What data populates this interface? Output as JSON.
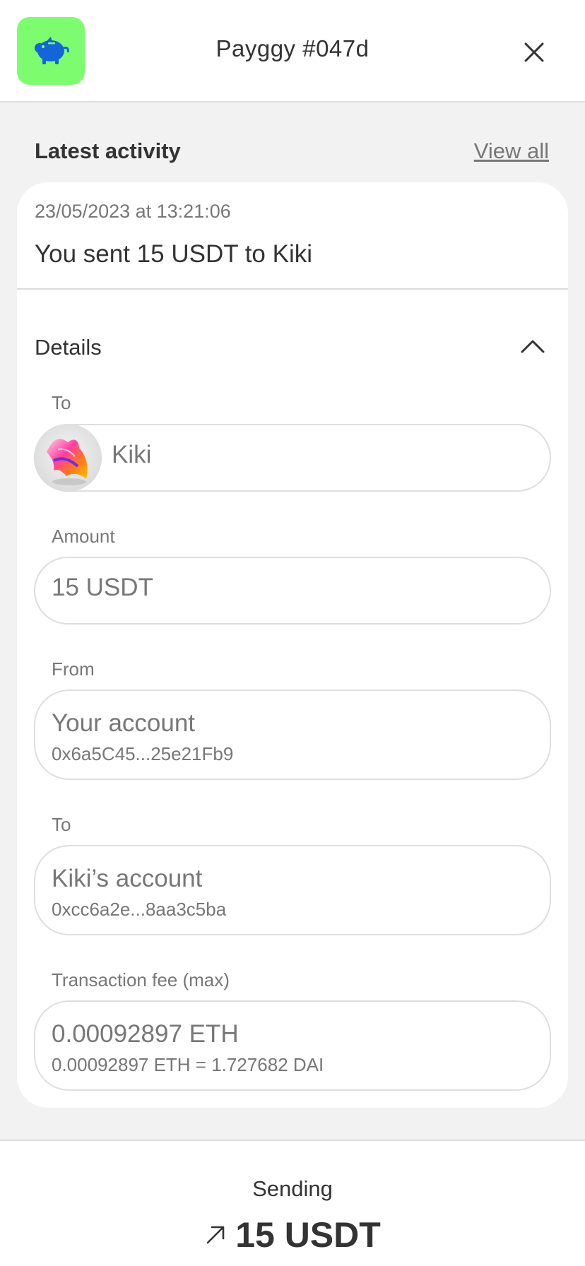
{
  "header": {
    "title": "Payggy #047d",
    "logo_icon": "piggy-bank-icon",
    "close_icon": "close-icon",
    "logo_bg": "#7efc6f",
    "logo_fg": "#1565d8"
  },
  "activity": {
    "section_title": "Latest activity",
    "view_all_label": "View all",
    "date": "23/05/2023 at 13:21:06",
    "summary": "You sent 15 USDT to Kiki",
    "details_label": "Details",
    "details_toggle_icon": "chevron-up-icon"
  },
  "fields": {
    "recipient": {
      "label": "To",
      "name": "Kiki",
      "avatar_icon": "shell-avatar-icon"
    },
    "amount": {
      "label": "Amount",
      "value": "15 USDT"
    },
    "from": {
      "label": "From",
      "title": "Your account",
      "address": "0x6a5C45...25e21Fb9"
    },
    "to_account": {
      "label": "To",
      "title": "Kiki’s account",
      "address": "0xcc6a2e...8aa3c5ba"
    },
    "fee": {
      "label": "Transaction fee (max)",
      "value": "0.00092897 ETH",
      "conversion": "0.00092897 ETH = 1.727682 DAI"
    }
  },
  "footer": {
    "status": "Sending",
    "amount": "15 USDT",
    "direction_icon": "arrow-up-right-icon"
  }
}
